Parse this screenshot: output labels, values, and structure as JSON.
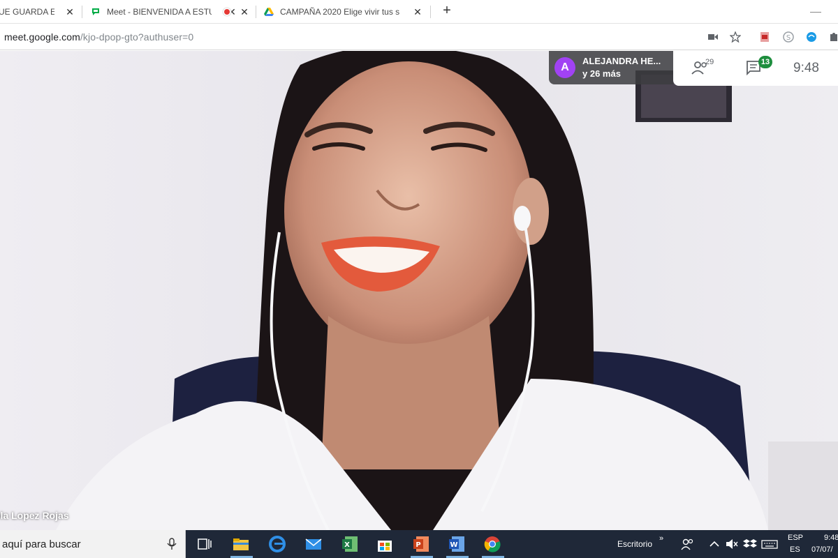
{
  "browser": {
    "tabs": [
      {
        "title": "UE GUARDA EL",
        "icon": "favicon-generic-icon"
      },
      {
        "title": "Meet - BIENVENIDA A ESTU",
        "icon": "meet-icon"
      },
      {
        "title": "CAMPAÑA 2020 Elige vivir tus s",
        "icon": "drive-icon",
        "recording": "record-dot-icon"
      }
    ],
    "new_tab_label": "+",
    "url_host": "meet.google.com",
    "url_path": "/kjo-dpop-gto?authuser=0"
  },
  "meet": {
    "presenter_initial": "A",
    "presenter_name": "ALEJANDRA HE...",
    "presenter_more": "y 26 más",
    "participants_count": "29",
    "chat_badge": "13",
    "time": "9:48",
    "tile_name": "ola Lopez Rojas",
    "colors": {
      "avatar": "#a142f4",
      "badge": "#1e8e3e"
    }
  },
  "taskbar": {
    "search_placeholder": "aquí para buscar",
    "desktop_label": "Escritorio",
    "desktop_chevron": "»",
    "lang_top": "ESP",
    "lang_bottom": "ES",
    "clock_time": "9:48",
    "clock_date": "07/07/"
  }
}
